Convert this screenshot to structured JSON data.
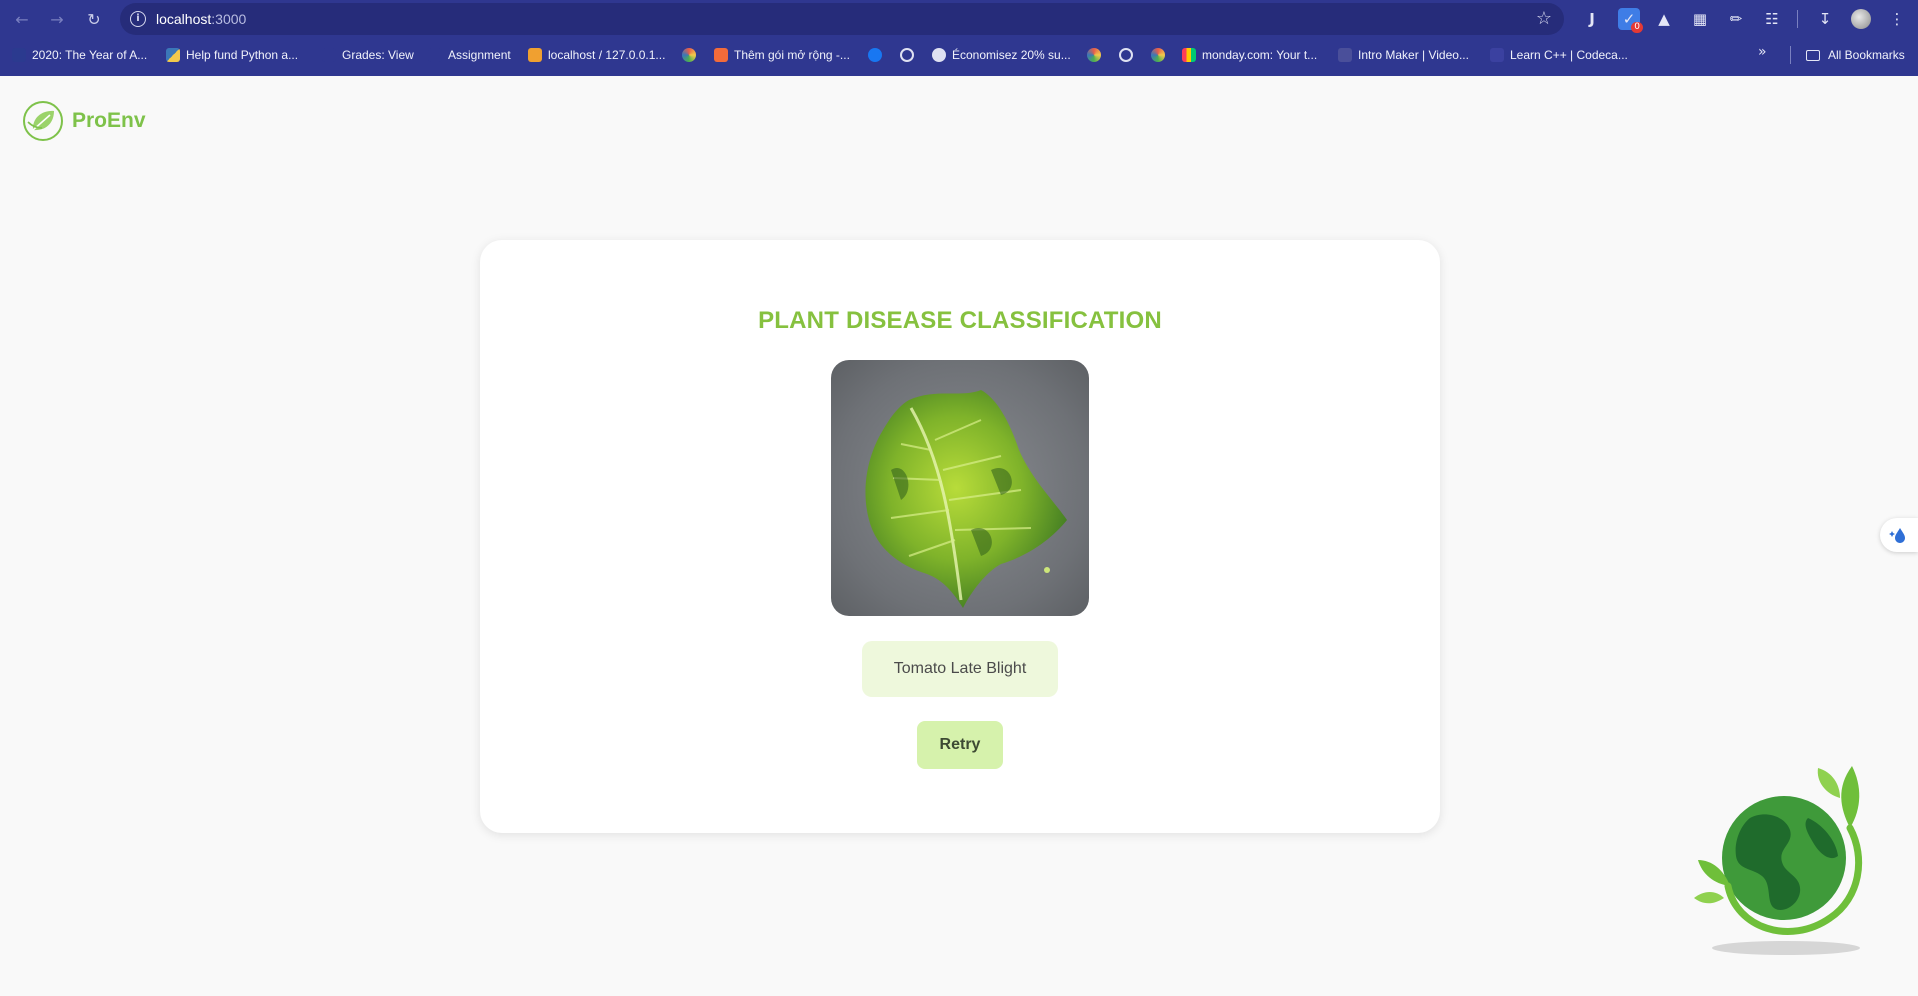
{
  "browser": {
    "url_host": "localhost",
    "url_port": ":3000",
    "extension_badge": "0",
    "bookmarks": [
      {
        "label": "2020: The Year of A...",
        "color": "#2b3a8f"
      },
      {
        "label": "Help fund Python a...",
        "color": "#f2c94c"
      },
      {
        "label": "Grades: View",
        "color": "#2f3790"
      },
      {
        "label": "Assignment",
        "color": "#2f3790"
      },
      {
        "label": "localhost / 127.0.0.1...",
        "color": "#f0a030"
      },
      {
        "label": "",
        "color": "#e85d4a"
      },
      {
        "label": "Thêm gói mở rộng -...",
        "color": "#f26b3a"
      },
      {
        "label": "",
        "color": "#1877f2"
      },
      {
        "label": "",
        "color": "#dfe1f2"
      },
      {
        "label": "Économisez 20% su...",
        "color": "#dfe1f2"
      },
      {
        "label": "",
        "color": "#e85d4a"
      },
      {
        "label": "",
        "color": "#dfe1f2"
      },
      {
        "label": "",
        "color": "#e85d4a"
      },
      {
        "label": "monday.com: Your t...",
        "color": "#ff3d57"
      },
      {
        "label": "Intro Maker | Video...",
        "color": "#4a4f9a"
      },
      {
        "label": "Learn C++ | Codeca...",
        "color": "#3b41a0"
      }
    ],
    "all_bookmarks_label": "All Bookmarks"
  },
  "app": {
    "brand": "ProEnv",
    "brand_color": "#7ec24a"
  },
  "classifier": {
    "title": "PLANT DISEASE CLASSIFICATION",
    "image_alt": "leaf-photo",
    "result_label": "Tomato Late Blight",
    "retry_label": "Retry"
  },
  "colors": {
    "chrome": "#2f3790",
    "title_green": "#86c13f",
    "result_bg": "#eef8dc",
    "retry_bg": "#d6f2ac"
  }
}
